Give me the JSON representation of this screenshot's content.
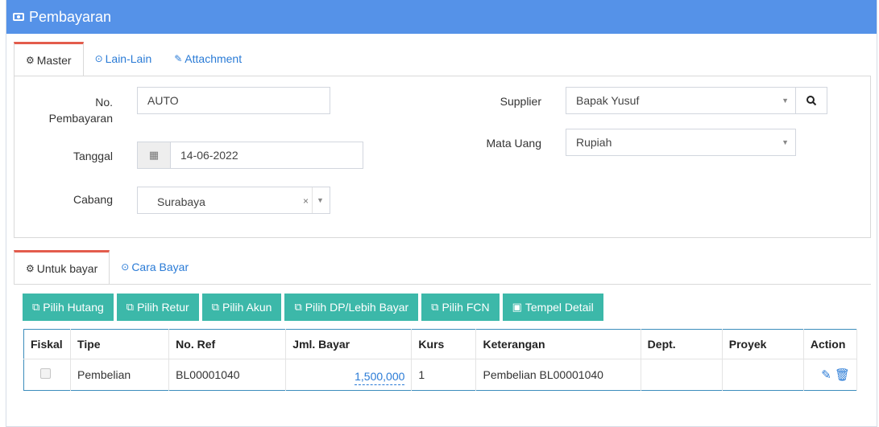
{
  "header": {
    "title": "Pembayaran",
    "icon": "money-icon"
  },
  "top_tabs": [
    {
      "label": "Master",
      "icon": "cogs-icon",
      "active": true
    },
    {
      "label": "Lain-Lain",
      "icon": "check-circle-icon",
      "active": false
    },
    {
      "label": "Attachment",
      "icon": "paperclip-icon",
      "active": false
    }
  ],
  "form": {
    "no_pembayaran_label_1": "No.",
    "no_pembayaran_label_2": "Pembayaran",
    "no_pembayaran_value": "AUTO",
    "tanggal_label": "Tanggal",
    "tanggal_value": "14-06-2022",
    "cabang_label": "Cabang",
    "cabang_value": "Surabaya",
    "supplier_label": "Supplier",
    "supplier_value": "Bapak Yusuf",
    "mata_uang_label": "Mata Uang",
    "mata_uang_value": "Rupiah"
  },
  "bottom_tabs": [
    {
      "label": "Untuk bayar",
      "icon": "cogs-icon",
      "active": true
    },
    {
      "label": "Cara Bayar",
      "icon": "check-circle-icon",
      "active": false
    }
  ],
  "toolbar": [
    "Pilih Hutang",
    "Pilih Retur",
    "Pilih Akun",
    "Pilih DP/Lebih Bayar",
    "Pilih FCN",
    "Tempel Detail"
  ],
  "table": {
    "headers": [
      "Fiskal",
      "Tipe",
      "No. Ref",
      "Jml. Bayar",
      "Kurs",
      "Keterangan",
      "Dept.",
      "Proyek",
      "Action"
    ],
    "rows": [
      {
        "fiskal": false,
        "tipe": "Pembelian",
        "no_ref": "BL00001040",
        "jml_bayar": "1,500,000",
        "kurs": "1",
        "keterangan": "Pembelian BL00001040",
        "dept": "",
        "proyek": ""
      }
    ]
  },
  "colors": {
    "header": "#5592e8",
    "button": "#3cb8a9",
    "link": "#2a7bd6",
    "tab_accent": "#e35c4c"
  }
}
